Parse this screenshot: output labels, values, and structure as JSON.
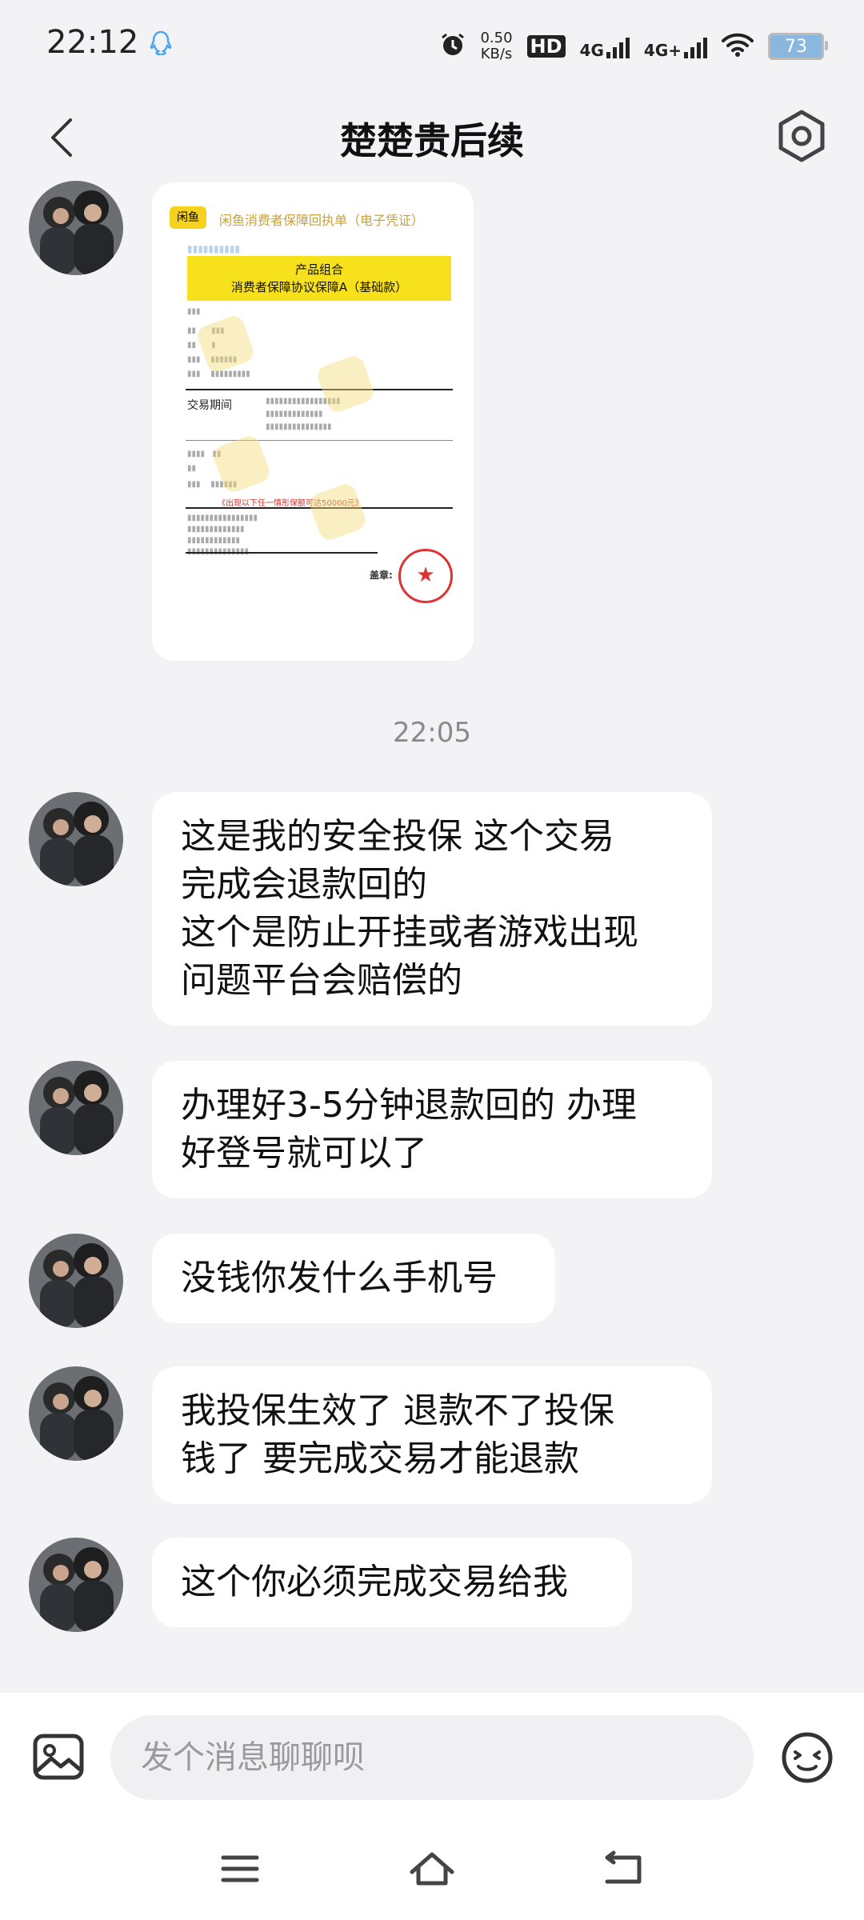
{
  "status_bar": {
    "time": "22:12",
    "net_speed_value": "0.50",
    "net_speed_unit": "KB/s",
    "hd": "HD",
    "network1": "4G",
    "network2": "4G+",
    "battery": "73"
  },
  "header": {
    "title": "楚楚贵后续"
  },
  "image_card": {
    "doc_title": "闲鱼消费者保障回执单（电子凭证）",
    "logo_text": "闲鱼",
    "product_line1": "产品组合",
    "product_line2": "消费者保障协议保障A（基础款）",
    "period_label": "交易期间",
    "seal_label": "盖章:",
    "footer_note": "《出现以下任一情形保额可达50000元》"
  },
  "timestamp": "22:05",
  "messages": [
    {
      "lines": [
        "这是我的安全投保 这个交易",
        "完成会退款回的",
        "这个是防止开挂或者游戏出现",
        "问题平台会赔偿的"
      ]
    },
    {
      "lines": [
        "办理好3-5分钟退款回的 办理",
        "好登号就可以了"
      ]
    },
    {
      "lines": [
        "没钱你发什么手机号"
      ]
    },
    {
      "lines": [
        "我投保生效了 退款不了投保",
        "钱了 要完成交易才能退款"
      ]
    },
    {
      "lines": [
        "这个你必须完成交易给我"
      ]
    }
  ],
  "input": {
    "placeholder": "发个消息聊聊呗"
  },
  "colors": {
    "background": "#f3f3f5",
    "bubble": "#ffffff",
    "accent_yellow": "#f7e01c"
  }
}
